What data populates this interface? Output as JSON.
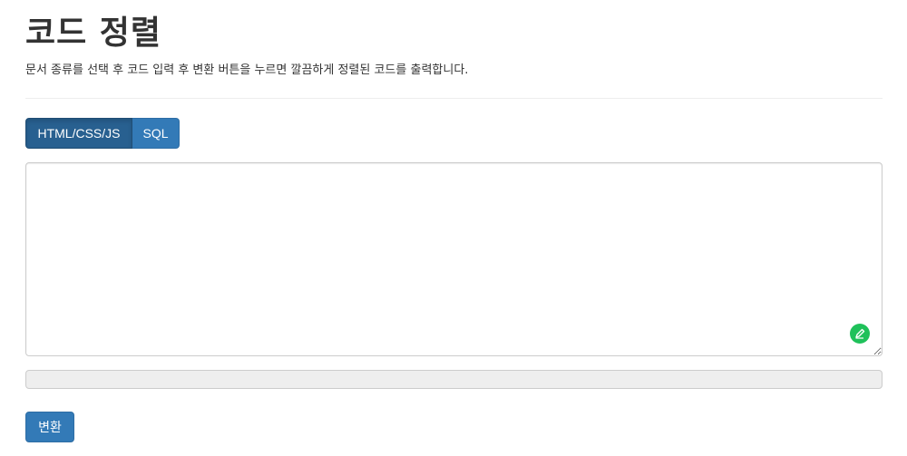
{
  "page": {
    "title": "코드 정렬",
    "description": "문서 종류를 선택 후 코드 입력 후 변환 버튼을 누르면 깔끔하게 정렬된 코드를 출력합니다."
  },
  "doc_type_toggle": {
    "options": [
      {
        "label": "HTML/CSS/JS",
        "selected": true
      },
      {
        "label": "SQL",
        "selected": false
      }
    ]
  },
  "code_input": {
    "value": "",
    "placeholder": ""
  },
  "output": {
    "value": ""
  },
  "convert_button": {
    "label": "변환"
  },
  "colors": {
    "primary": "#337ab7",
    "primary_active": "#286090",
    "edit_badge": "#1fc15a"
  },
  "icons": {
    "edit_badge": "pen-icon"
  }
}
